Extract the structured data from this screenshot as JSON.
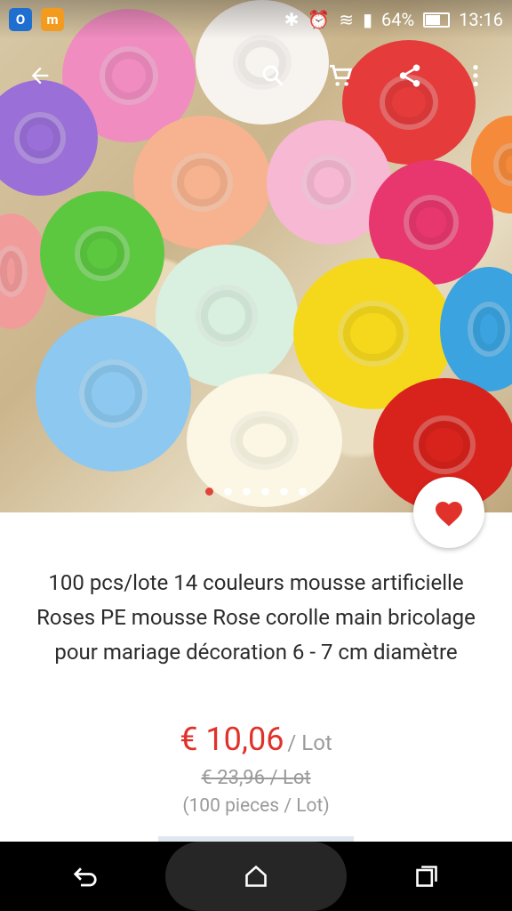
{
  "status_bar": {
    "left_apps": [
      {
        "label": "O",
        "color": "#1e6fcf"
      },
      {
        "label": "m",
        "color": "#f29b1f"
      }
    ],
    "battery": "64%",
    "time": "13:16"
  },
  "toolbar": {
    "back_icon": "arrow-back-icon",
    "search_icon": "search-icon",
    "cart_icon": "cart-icon",
    "share_icon": "share-icon",
    "more_icon": "more-vert-icon"
  },
  "carousel": {
    "total": 6,
    "active": 1
  },
  "product": {
    "title": "100 pcs/lote 14 couleurs mousse artificielle Roses PE mousse Rose corolle main bricolage pour mariage décoration 6 - 7 cm diamètre",
    "price": "€ 10,06",
    "price_unit": "/ Lot",
    "old_price": "€ 23,96 / Lot",
    "pieces": "(100 pieces / Lot)"
  },
  "colors": {
    "accent": "#e0322a",
    "muted": "#9a9a9a"
  }
}
